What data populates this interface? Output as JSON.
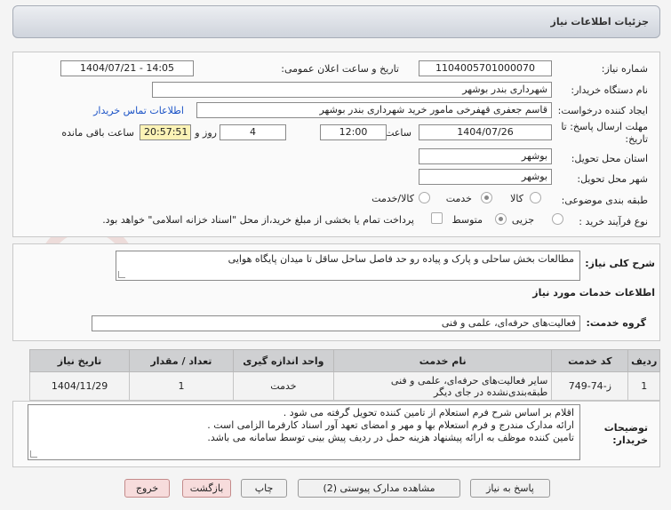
{
  "header": {
    "title": "جزئیات اطلاعات نیاز"
  },
  "form": {
    "need_number_label": "شماره نیاز:",
    "need_number": "1104005701000070",
    "announce_label": "تاریخ و ساعت اعلان عمومی:",
    "announce_value": "1404/07/21 - 14:05",
    "buyer_label": "نام دستگاه خریدار:",
    "buyer_value": "شهرداری بندر بوشهر",
    "creator_label": "ایجاد کننده درخواست:",
    "creator_value": "قاسم جعفری قهفرخی مامور خرید  شهرداری بندر بوشهر",
    "contact_link": "اطلاعات تماس خریدار",
    "deadline_label_1": "مهلت ارسال پاسخ: تا",
    "deadline_label_2": "تاریخ:",
    "deadline_date": "1404/07/26",
    "time_label": "ساعت",
    "deadline_time": "12:00",
    "days_value": "4",
    "days_label": "روز و",
    "remaining_time": "20:57:51",
    "remaining_label": "ساعت باقی مانده",
    "province_label": "استان محل تحویل:",
    "province_value": "بوشهر",
    "city_label": "شهر محل تحویل:",
    "city_value": "بوشهر",
    "category_label": "طبقه بندی موضوعی:",
    "category_options": [
      {
        "label": "کالا",
        "selected": false
      },
      {
        "label": "خدمت",
        "selected": true
      },
      {
        "label": "کالا/خدمت",
        "selected": false
      }
    ],
    "process_label": "نوع فرآیند خرید :",
    "process_options": [
      {
        "label": "جزیی",
        "selected": false
      },
      {
        "label": "متوسط",
        "selected": true
      }
    ],
    "payment_note": "پرداخت تمام یا بخشی از مبلغ خرید،از محل \"اسناد خزانه اسلامی\" خواهد بود."
  },
  "summary": {
    "label": "شرح کلی نیاز:",
    "value": "مطالعات بخش ساحلی و پارک و پیاده رو حد فاصل ساحل ساقل تا میدان پایگاه هوایی"
  },
  "services": {
    "section_title": "اطلاعات خدمات مورد نیاز",
    "group_label": "گروه خدمت:",
    "group_value": "فعالیت‌های حرفه‌ای، علمی و فنی",
    "columns": [
      "ردیف",
      "کد خدمت",
      "نام خدمت",
      "واحد اندازه گیری",
      "تعداد / مقدار",
      "تاریخ نیاز"
    ],
    "rows": [
      [
        "1",
        "ز-74-749",
        "سایر فعالیت‌های حرفه‌ای، علمی و فنی طبقه‌بندی‌نشده در جای دیگر",
        "خدمت",
        "1",
        "1404/11/29"
      ]
    ]
  },
  "notes": {
    "label_1": "توضیحات",
    "label_2": "خریدار:",
    "lines": [
      "اقلام بر اساس شرح فرم استعلام از تامین کننده تحویل گرفته می شود .",
      "ارائه مدارک مندرج و فرم استعلام بها و مهر و امضای تعهد آور اسناد کارفرما الزامی است .",
      "تامین  کننده موظف به ارائه پیشنهاد هزینه حمل در ردیف پیش بینی توسط سامانه می باشد."
    ]
  },
  "buttons": {
    "reply": "پاسخ به نیاز",
    "attachments": "مشاهده مدارک پیوستی (2)",
    "print": "چاپ",
    "back": "بازگشت",
    "exit": "خروج"
  },
  "watermark": {
    "text": "AriaTender.net"
  },
  "colors": {
    "link": "#1a52c6",
    "remaining_bg": "#fbf3b6",
    "exit_bg": "#f7dcdc"
  }
}
